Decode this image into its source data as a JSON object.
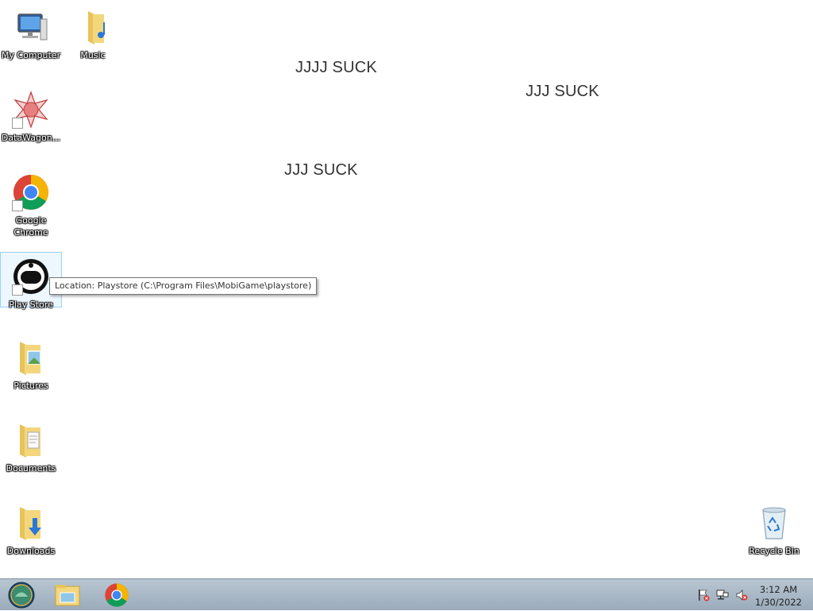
{
  "desktop": {
    "icons": [
      {
        "label": "My Computer"
      },
      {
        "label": "Music"
      },
      {
        "label": "DataWagon..."
      },
      {
        "label": "Google Chrome"
      },
      {
        "label": "Play Store"
      },
      {
        "label": "Pictures"
      },
      {
        "label": "Documents"
      },
      {
        "label": "Downloads"
      },
      {
        "label": "Recycle Bin"
      }
    ],
    "texts": [
      "JJJJ SUCK",
      "JJJ SUCK",
      "JJJ SUCK"
    ],
    "tooltip": "Location: Playstore (C:\\Program Files\\MobiGame\\playstore)"
  },
  "taskbar": {
    "clock_time": "3:12 AM",
    "clock_date": "1/30/2022"
  },
  "colors": {
    "taskbar_top": "#b9c6d2",
    "taskbar_bottom": "#9aabbb",
    "selection_border": "#99d1ff"
  }
}
